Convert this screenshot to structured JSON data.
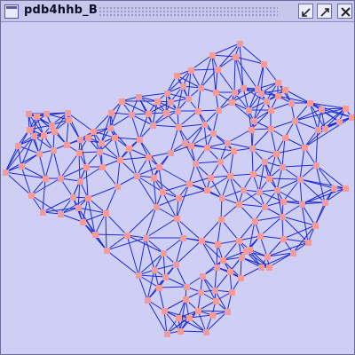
{
  "window": {
    "title": "pdb4hhb_B",
    "icon": "window-icon",
    "controls": [
      {
        "name": "minimize",
        "icon": "minimize-icon"
      },
      {
        "name": "maximize",
        "icon": "maximize-icon"
      },
      {
        "name": "close",
        "icon": "close-icon"
      }
    ]
  },
  "colors": {
    "background": "#cfcff6",
    "titlebar": "#c7c7ec",
    "edge": "#1d2bd3",
    "node": "#f39b9b"
  }
}
